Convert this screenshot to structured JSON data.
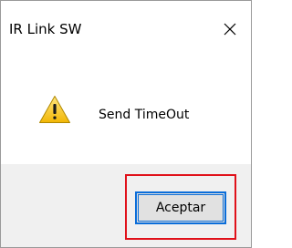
{
  "window": {
    "title": "IR Link SW",
    "close_icon": "close-icon"
  },
  "message": {
    "icon": "warning-icon",
    "text": "Send TimeOut"
  },
  "buttons": {
    "ok_label": "Aceptar"
  },
  "colors": {
    "highlight": "#e0111a",
    "button_focus": "#0a6dd9",
    "warning_fill": "#f5c518"
  }
}
